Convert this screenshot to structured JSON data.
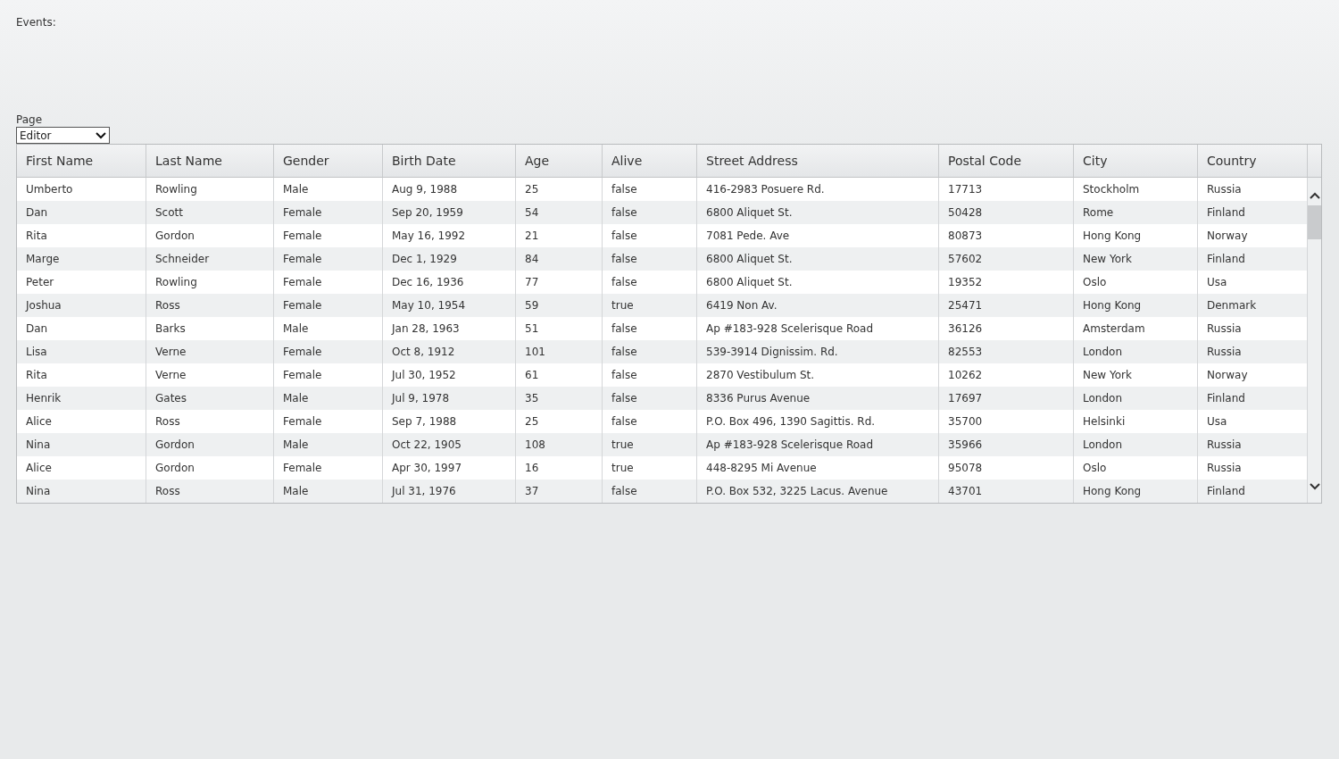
{
  "events_label": "Events:",
  "page_select": {
    "label": "Page",
    "value": "Editor"
  },
  "table": {
    "columns": [
      "First Name",
      "Last Name",
      "Gender",
      "Birth Date",
      "Age",
      "Alive",
      "Street Address",
      "Postal Code",
      "City",
      "Country"
    ],
    "rows": [
      [
        "Umberto",
        "Rowling",
        "Male",
        "Aug 9, 1988",
        "25",
        "false",
        "416-2983 Posuere Rd.",
        "17713",
        "Stockholm",
        "Russia"
      ],
      [
        "Dan",
        "Scott",
        "Female",
        "Sep 20, 1959",
        "54",
        "false",
        "6800 Aliquet St.",
        "50428",
        "Rome",
        "Finland"
      ],
      [
        "Rita",
        "Gordon",
        "Female",
        "May 16, 1992",
        "21",
        "false",
        "7081 Pede. Ave",
        "80873",
        "Hong Kong",
        "Norway"
      ],
      [
        "Marge",
        "Schneider",
        "Female",
        "Dec 1, 1929",
        "84",
        "false",
        "6800 Aliquet St.",
        "57602",
        "New York",
        "Finland"
      ],
      [
        "Peter",
        "Rowling",
        "Female",
        "Dec 16, 1936",
        "77",
        "false",
        "6800 Aliquet St.",
        "19352",
        "Oslo",
        "Usa"
      ],
      [
        "Joshua",
        "Ross",
        "Female",
        "May 10, 1954",
        "59",
        "true",
        "6419 Non Av.",
        "25471",
        "Hong Kong",
        "Denmark"
      ],
      [
        "Dan",
        "Barks",
        "Male",
        "Jan 28, 1963",
        "51",
        "false",
        "Ap #183-928 Scelerisque Road",
        "36126",
        "Amsterdam",
        "Russia"
      ],
      [
        "Lisa",
        "Verne",
        "Female",
        "Oct 8, 1912",
        "101",
        "false",
        "539-3914 Dignissim. Rd.",
        "82553",
        "London",
        "Russia"
      ],
      [
        "Rita",
        "Verne",
        "Female",
        "Jul 30, 1952",
        "61",
        "false",
        "2870 Vestibulum St.",
        "10262",
        "New York",
        "Norway"
      ],
      [
        "Henrik",
        "Gates",
        "Male",
        "Jul 9, 1978",
        "35",
        "false",
        "8336 Purus Avenue",
        "17697",
        "London",
        "Finland"
      ],
      [
        "Alice",
        "Ross",
        "Female",
        "Sep 7, 1988",
        "25",
        "false",
        "P.O. Box 496, 1390 Sagittis. Rd.",
        "35700",
        "Helsinki",
        "Usa"
      ],
      [
        "Nina",
        "Gordon",
        "Male",
        "Oct 22, 1905",
        "108",
        "true",
        "Ap #183-928 Scelerisque Road",
        "35966",
        "London",
        "Russia"
      ],
      [
        "Alice",
        "Gordon",
        "Female",
        "Apr 30, 1997",
        "16",
        "true",
        "448-8295 Mi Avenue",
        "95078",
        "Oslo",
        "Russia"
      ],
      [
        "Nina",
        "Ross",
        "Male",
        "Jul 31, 1976",
        "37",
        "false",
        "P.O. Box 532, 3225 Lacus. Avenue",
        "43701",
        "Hong Kong",
        "Finland"
      ]
    ]
  }
}
